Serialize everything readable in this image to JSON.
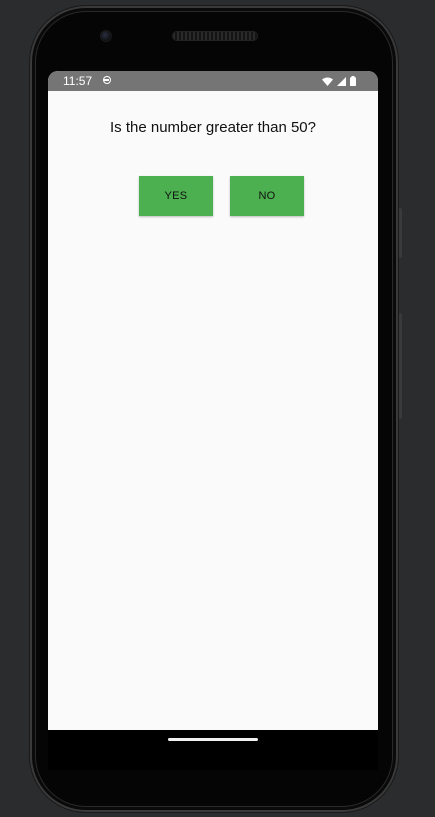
{
  "status_bar": {
    "time": "11:57",
    "icons": [
      "app-notification-icon",
      "wifi-icon",
      "signal-icon",
      "battery-icon"
    ],
    "background": "#757575"
  },
  "main": {
    "question": "Is the number greater than 50?",
    "yes_label": "YES",
    "no_label": "NO",
    "button_color": "#4caf50",
    "background": "#fafafa"
  },
  "device": {
    "frame_color": "#050505",
    "backdrop_color": "#2b2c2e"
  }
}
